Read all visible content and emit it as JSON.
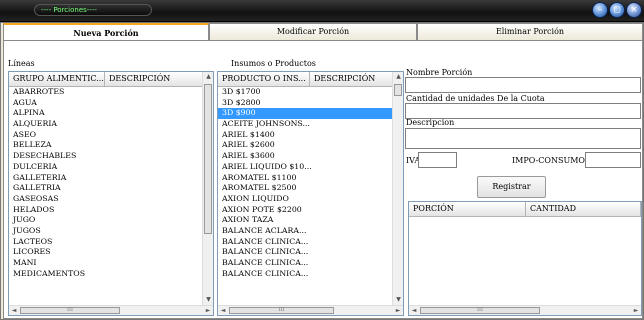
{
  "window": {
    "title": "---- Porciones----"
  },
  "tabs": [
    {
      "label": "Nueva Porción"
    },
    {
      "label": "Modificar Porción"
    },
    {
      "label": "Eliminar Porción"
    }
  ],
  "lineas": {
    "label": "Líneas",
    "columns": [
      "GRUPO ALIMENTIC...",
      "DESCRIPCIÓN"
    ],
    "rows": [
      "ABARROTES",
      "AGUA",
      "ALPINA",
      "ALQUERIA",
      "ASEO",
      "BELLEZA",
      "DESECHABLES",
      "DULCERIA",
      "GALLETERIA",
      "GALLETRIA",
      "GASEOSAS",
      "HELADOS",
      "JUGO",
      "JUGOS",
      "LACTEOS",
      "LICORES",
      "MANI",
      "MEDICAMENTOS"
    ]
  },
  "insumos": {
    "label": "Insumos o Productos",
    "columns": [
      "PRODUCTO O INS...",
      "DESCRIPCIÓN"
    ],
    "rows": [
      "3D $1700",
      "3D $2800",
      "3D $900",
      "ACEITE JOHNSONS...",
      "ARIEL $1400",
      "ARIEL $2600",
      "ARIEL $3600",
      "ARIEL LIQUIDO $10...",
      "AROMATEL $1100",
      "AROMATEL $2500",
      "AXION LIQUIDO",
      "AXION POTE $2200",
      "AXION TAZA",
      "BALANCE ACLARA...",
      "BALANCE CLINICA...",
      "BALANCE CLINICA...",
      "BALANCE CLINICA...",
      "BALANCE CLINICA..."
    ],
    "selected_index": 2
  },
  "form": {
    "nombre_label": "Nombre Porción",
    "cantidad_label": "Cantidad de unidades De la Cuota",
    "descripcion_label": "Descripcion",
    "iva_label": "IVA",
    "impo_label": "IMPO-CONSUMO",
    "registrar_label": "Registrar"
  },
  "porciones": {
    "columns": [
      "PORCIÓN",
      "CANTIDAD"
    ]
  }
}
